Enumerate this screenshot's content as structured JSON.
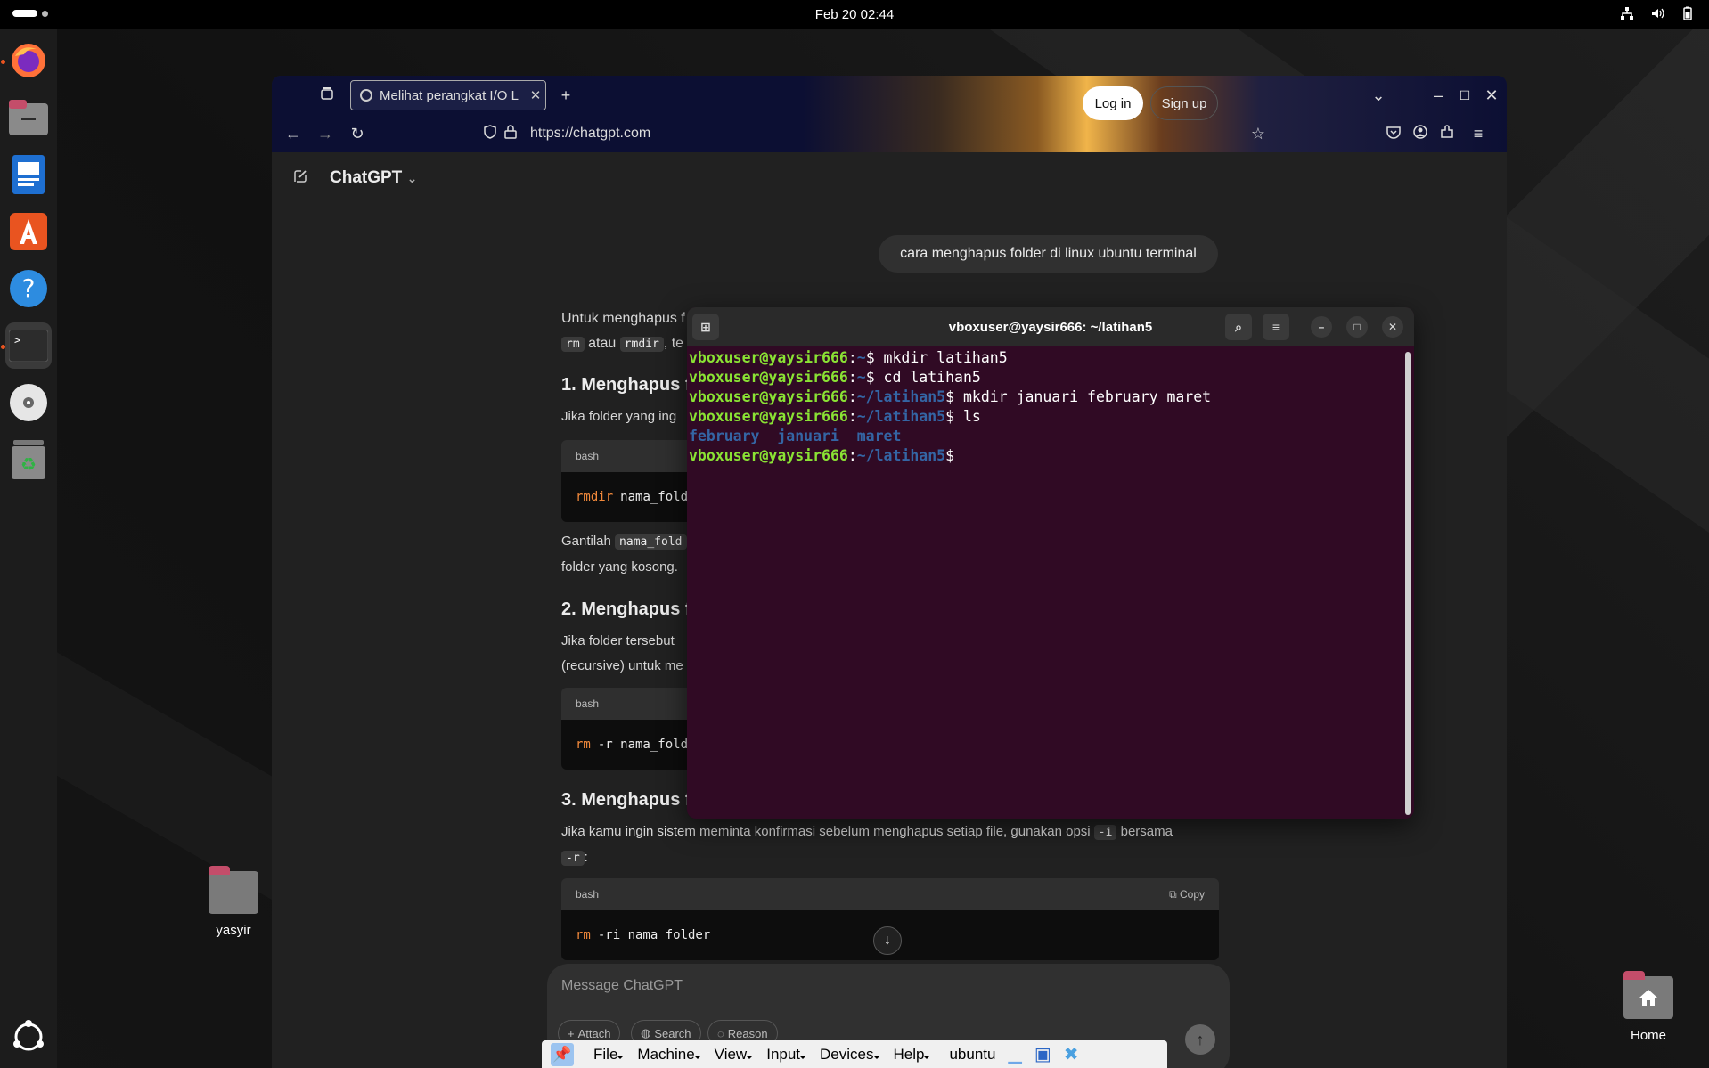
{
  "topbar": {
    "datetime": "Feb 20  02:44"
  },
  "dock": {
    "items": [
      {
        "name": "firefox",
        "icon": "firefox-icon"
      },
      {
        "name": "files",
        "icon": "files-icon"
      },
      {
        "name": "writer",
        "icon": "writer-icon"
      },
      {
        "name": "app-center",
        "icon": "app-center-icon"
      },
      {
        "name": "help",
        "icon": "help-icon"
      },
      {
        "name": "terminal",
        "icon": "terminal-icon"
      },
      {
        "name": "disc",
        "icon": "disc-icon"
      },
      {
        "name": "trash",
        "icon": "trash-icon"
      }
    ]
  },
  "desktop": {
    "folder_label": "yasyir",
    "home_label": "Home"
  },
  "browser": {
    "tab_title": "Melihat perangkat I/O Lin",
    "url": "https://chatgpt.com",
    "app_title": "ChatGPT",
    "login": "Log in",
    "signup": "Sign up"
  },
  "chat": {
    "user_message": "cara menghapus folder di linux ubuntu terminal",
    "intro": "Untuk menghapus f",
    "intro_code1": "rm",
    "intro_and": "atau",
    "intro_code2": "rmdir",
    "intro_tail": ", te",
    "h1": "1. Menghapus f",
    "p1": "Jika folder yang ing",
    "lang": "bash",
    "code1_cmd": "rmdir",
    "code1_arg": "nama_fold",
    "p2a": "Gantilah",
    "p2_code": "nama_fold",
    "p2b": "folder yang kosong.",
    "h2": "2. Menghapus f",
    "p3a": "Jika folder tersebut",
    "p3b": "(recursive) untuk me",
    "code2_cmd": "rm",
    "code2_arg": "-r nama_fold",
    "h3": "3. Menghapus f",
    "p4": "Jika kamu ingin sistem meminta konfirmasi sebelum menghapus setiap file, gunakan opsi",
    "p4_code": "-i",
    "p4_tail": "bersama",
    "p4_code2": "-r",
    "p4_colon": ":",
    "copy": "Copy",
    "code3_cmd": "rm",
    "code3_arg": "-ri nama_folder",
    "composer_placeholder": "Message ChatGPT",
    "attach": "Attach",
    "search": "Search",
    "reason": "Reason"
  },
  "terminal": {
    "title": "vboxuser@yaysir666: ~/latihan5",
    "lines": [
      {
        "user": "vboxuser@yaysir666",
        "path": "~",
        "cmd": "mkdir latihan5"
      },
      {
        "user": "vboxuser@yaysir666",
        "path": "~",
        "cmd": "cd latihan5"
      },
      {
        "user": "vboxuser@yaysir666",
        "path": "~/latihan5",
        "cmd": "mkdir januari february maret"
      },
      {
        "user": "vboxuser@yaysir666",
        "path": "~/latihan5",
        "cmd": "ls"
      }
    ],
    "ls_output": "february  januari  maret",
    "last_user": "vboxuser@yaysir666",
    "last_path": "~/latihan5"
  },
  "vbox_menu": {
    "items": [
      "File",
      "Machine",
      "View",
      "Input",
      "Devices",
      "Help"
    ],
    "vm_name": "ubuntu"
  },
  "colors": {
    "terminal_bg": "#300a24",
    "prompt_green": "#8ae234",
    "prompt_blue": "#3465a4",
    "ubuntu_orange": "#e95420"
  }
}
